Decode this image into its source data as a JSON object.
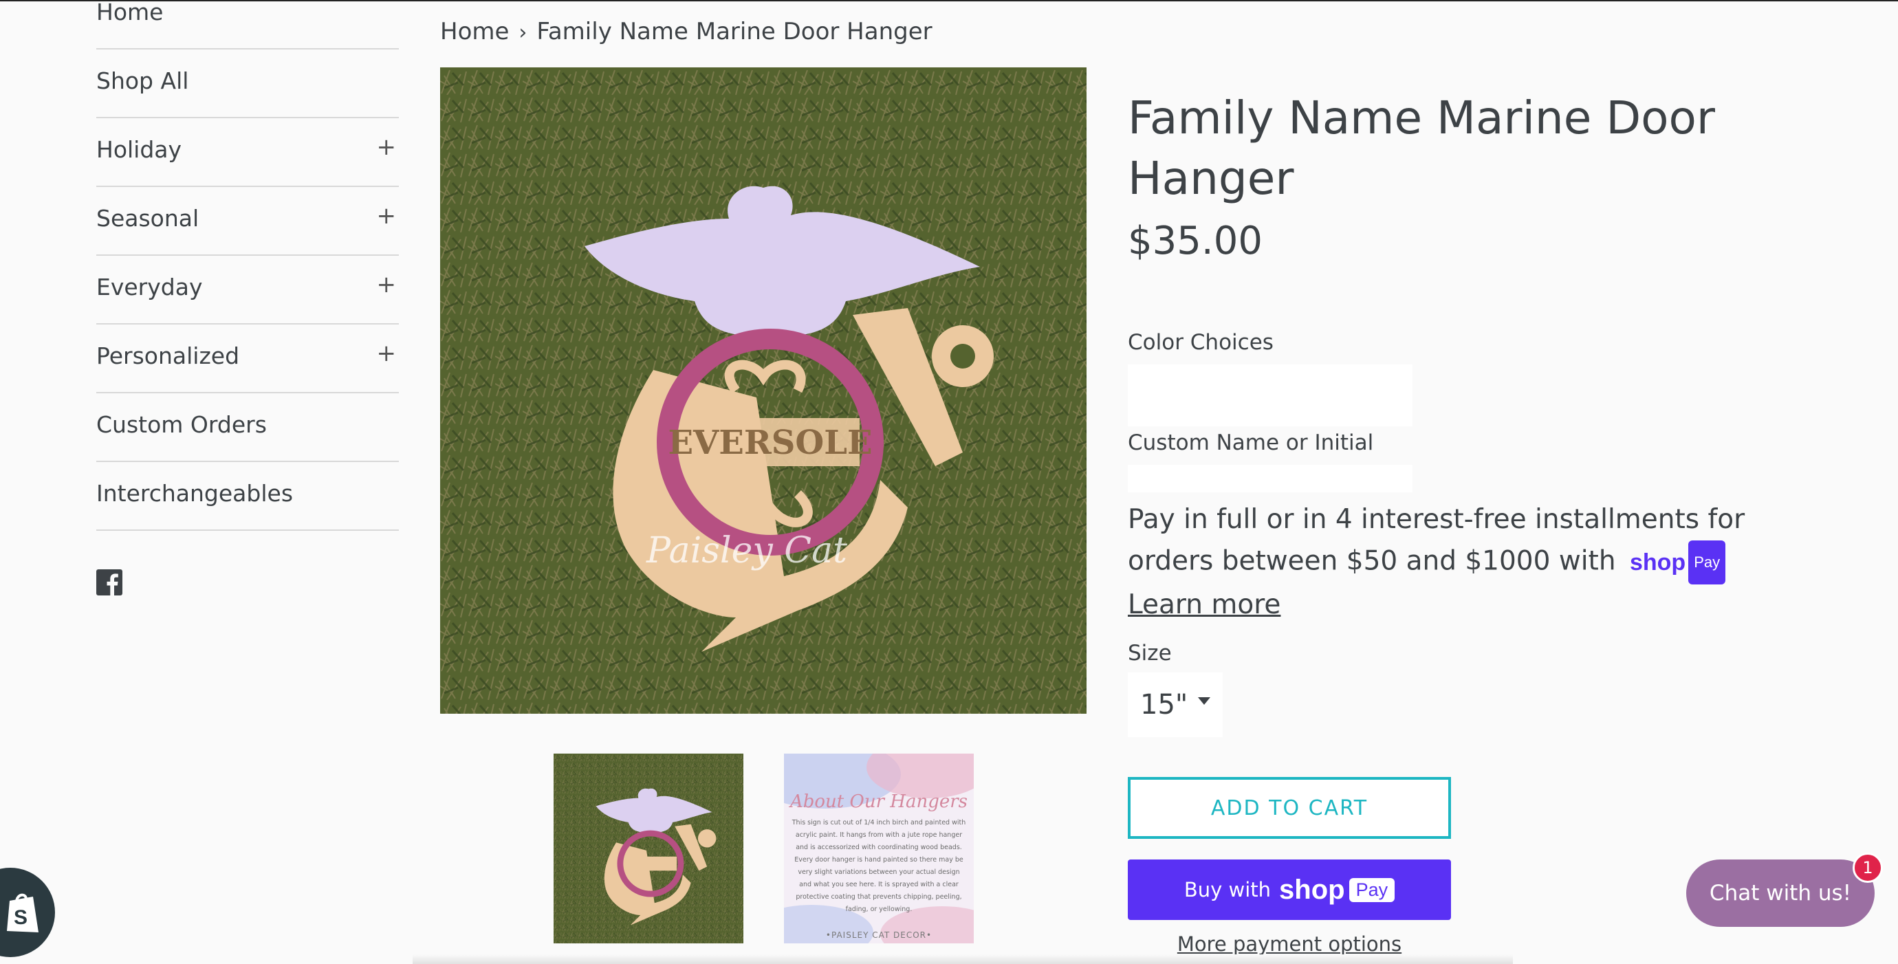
{
  "sidebar": {
    "items": [
      {
        "label": "Home",
        "expandable": false
      },
      {
        "label": "Shop All",
        "expandable": false
      },
      {
        "label": "Holiday",
        "expandable": true
      },
      {
        "label": "Seasonal",
        "expandable": true
      },
      {
        "label": "Everyday",
        "expandable": true
      },
      {
        "label": "Personalized",
        "expandable": true
      },
      {
        "label": "Custom Orders",
        "expandable": false
      },
      {
        "label": "Interchangeables",
        "expandable": false
      }
    ],
    "expand_symbol": "+",
    "social_icon": "facebook-icon"
  },
  "breadcrumb": {
    "home": "Home",
    "separator": "›",
    "current": "Family Name Marine Door Hanger"
  },
  "product": {
    "title": "Family Name Marine Door Hanger",
    "price": "$35.00",
    "color_label": "Color Choices",
    "custom_label": "Custom Name or Initial",
    "installments_text": "Pay in full or in 4 interest-free installments for orders between $50 and $1000 with",
    "shop_word": "shop",
    "pay_word": "Pay",
    "learn_more": "Learn more",
    "size_label": "Size",
    "size_value": "15\"",
    "add_to_cart": "ADD TO CART",
    "buy_with": "Buy with",
    "more_payment": "More payment options"
  },
  "image_texts": {
    "main_name": "EVERSOLE",
    "watermark": "Paisley Cat",
    "thumb2_heading": "About Our Hangers",
    "thumb2_body": "This sign is cut out of 1/4 inch birch and painted with acrylic paint. It hangs from with a jute rope hanger and is accessorized with coordinating wood beads. Every door hanger is hand painted so there may be very slight variations between your actual design and what you see here. It is sprayed with a clear protective coating that prevents chipping, peeling, fading, or yellowing.",
    "thumb2_footer": "•PAISLEY CAT DECOR•"
  },
  "chat": {
    "label": "Chat with us!",
    "badge": "1"
  },
  "colors": {
    "accent": "#1db6c2",
    "shop_pay": "#5a31f4",
    "chat": "#9b6fa2",
    "badge": "#e0234a"
  }
}
